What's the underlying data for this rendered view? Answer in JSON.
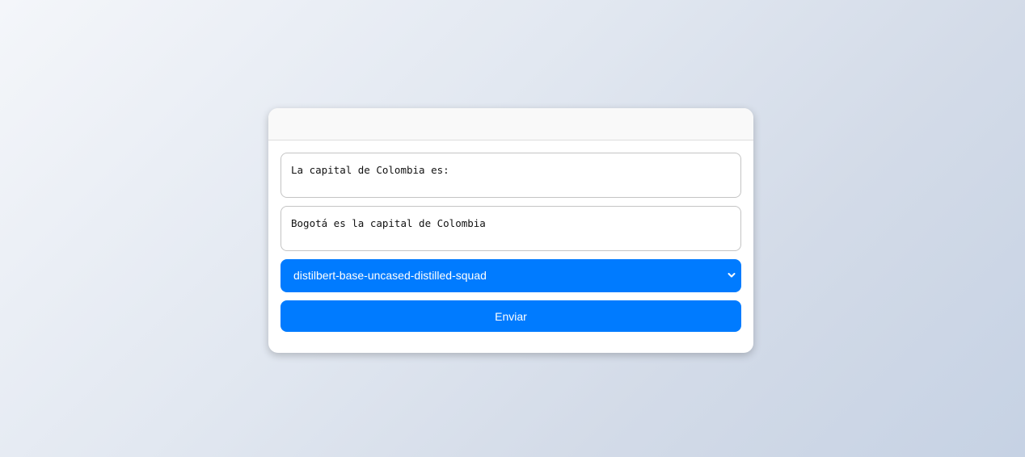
{
  "form": {
    "question_value": "La capital de Colombia es:",
    "context_value": "Bogotá es la capital de Colombia",
    "model_selected": "distilbert-base-uncased-distilled-squad",
    "submit_label": "Enviar"
  },
  "colors": {
    "accent": "#007bff",
    "card_bg": "#ffffff",
    "header_bg": "#f9f9f9"
  },
  "icons": {
    "select_arrow": "chevron-down-icon"
  }
}
